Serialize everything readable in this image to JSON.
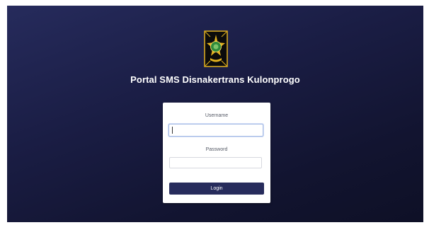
{
  "portal": {
    "title": "Portal SMS Disnakertrans Kulonprogo",
    "logo_icon": "kulonprogo-emblem-icon"
  },
  "login_form": {
    "username_label": "Username",
    "username_value": "",
    "password_label": "Password",
    "password_value": "",
    "login_label": "Login"
  },
  "colors": {
    "background_dark": "#121430",
    "background_light": "#262b5c",
    "button": "#272c5c",
    "emblem_gold": "#e3b21f",
    "emblem_green": "#2e8a3c"
  }
}
